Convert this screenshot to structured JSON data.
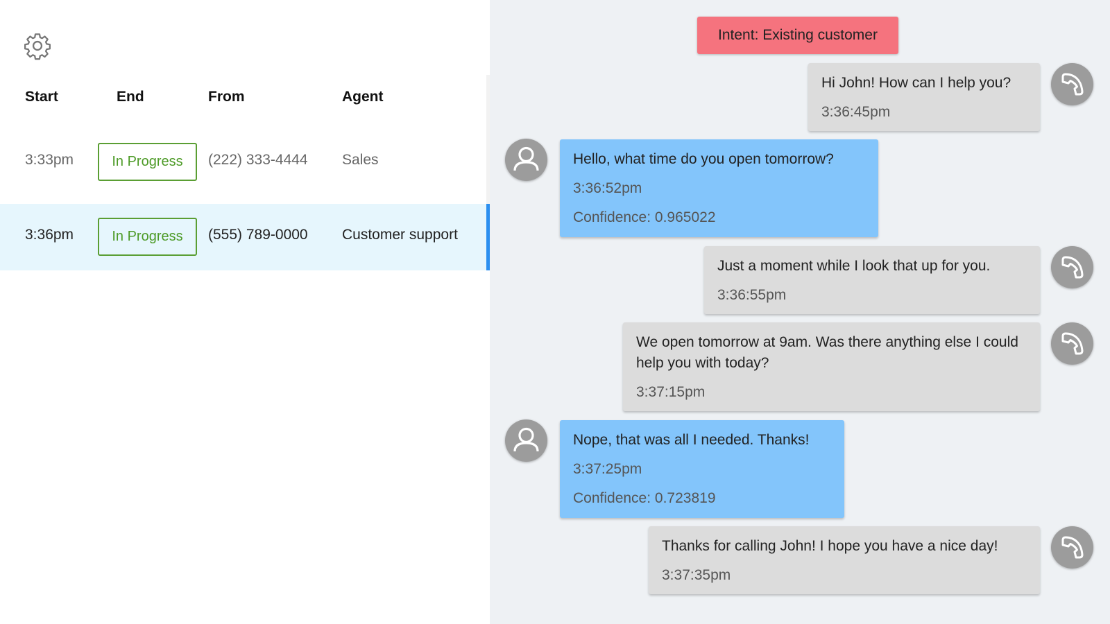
{
  "sidebar": {
    "settings_icon": "gear-icon",
    "columns": {
      "start": "Start",
      "end": "End",
      "from": "From",
      "agent": "Agent"
    },
    "calls": [
      {
        "start": "3:33pm",
        "status": "In Progress",
        "from": "(222) 333-4444",
        "agent": "Sales",
        "selected": false
      },
      {
        "start": "3:36pm",
        "status": "In Progress",
        "from": "(555) 789-0000",
        "agent": "Customer support",
        "selected": true
      }
    ]
  },
  "conversation": {
    "intent": "Intent: Existing customer",
    "messages": [
      {
        "role": "agent",
        "text": "Hi John! How can I help you?",
        "time": "3:36:45pm",
        "icon": "phone-icon"
      },
      {
        "role": "caller",
        "text": "Hello, what time do you open tomorrow?",
        "time": "3:36:52pm",
        "confidence": "Confidence: 0.965022",
        "icon": "user-avatar-icon"
      },
      {
        "role": "agent",
        "text": "Just a moment while I look that up for you.",
        "time": "3:36:55pm",
        "icon": "phone-icon"
      },
      {
        "role": "agent",
        "text": "We open tomorrow at 9am. Was there anything else I could help you with today?",
        "time": "3:37:15pm",
        "icon": "phone-icon"
      },
      {
        "role": "caller",
        "text": "Nope, that was all I needed. Thanks!",
        "time": "3:37:25pm",
        "confidence": "Confidence: 0.723819",
        "icon": "user-avatar-icon"
      },
      {
        "role": "agent",
        "text": "Thanks for calling John! I hope you have a nice day!",
        "time": "3:37:35pm",
        "icon": "phone-icon"
      }
    ]
  },
  "colors": {
    "status_green": "#4c9a26",
    "selected_row": "#e6f6fd",
    "selected_accent": "#2b8ff0",
    "intent_badge": "#f5737e",
    "agent_bubble": "#dcdcdc",
    "caller_bubble": "#83c5fb",
    "conversation_bg": "#eef1f4"
  }
}
